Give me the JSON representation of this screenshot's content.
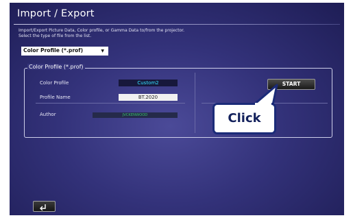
{
  "window": {
    "title": "Import / Export",
    "description": "Import/Export Picture Data, Color profile, or Gamma Data to/from the projector.\nSelect the type of file from the list."
  },
  "file_type_select": {
    "selected": "Color Profile (*.prof)",
    "icon": "chevron-down-icon"
  },
  "panel": {
    "legend": "Color Profile (*.prof)",
    "rows": {
      "color_profile_label": "Color Profile",
      "color_profile_value": "Custom2",
      "profile_name_label": "Profile Name",
      "profile_name_value": "BT.2020",
      "author_label": "Author",
      "author_value": "JVCKENWOOD"
    }
  },
  "actions": {
    "start_label": "START",
    "back_icon": "return-arrow-icon"
  },
  "callout": {
    "text": "Click"
  },
  "colors": {
    "background": "#33327a",
    "value_cyan": "#33e3ff",
    "author_green": "#37c26a",
    "callout_border": "#1b2b78"
  }
}
